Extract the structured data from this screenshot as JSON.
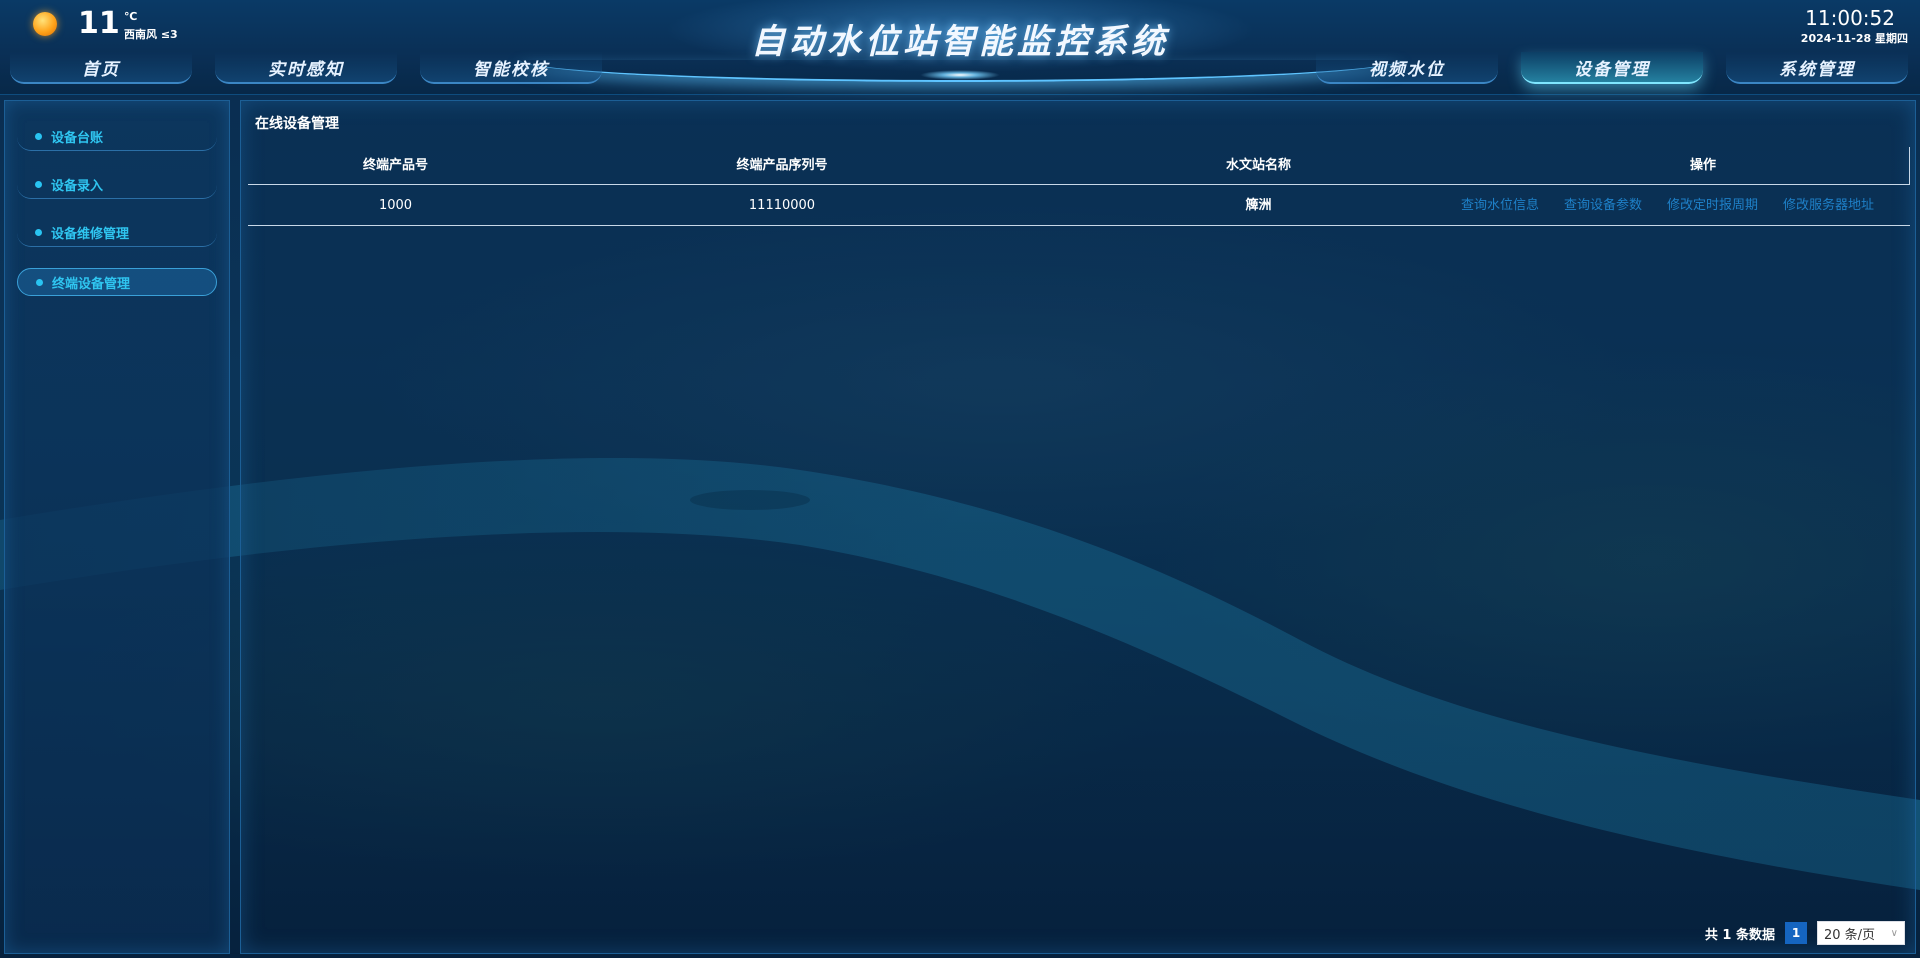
{
  "header": {
    "title": "自动水位站智能监控系统",
    "weather": {
      "icon": "sun-icon",
      "temperature": "11",
      "unit": "℃",
      "wind": "西南风 ≤3"
    },
    "time": "11:00:52",
    "date": "2024-11-28 星期四",
    "nav": [
      {
        "label": "首页",
        "active": false
      },
      {
        "label": "实时感知",
        "active": false
      },
      {
        "label": "智能校核",
        "active": false
      },
      {
        "label": "视频水位",
        "active": false
      },
      {
        "label": "设备管理",
        "active": true
      },
      {
        "label": "系统管理",
        "active": false
      }
    ]
  },
  "sidebar": {
    "items": [
      {
        "label": "设备台账",
        "active": false
      },
      {
        "label": "设备录入",
        "active": false
      },
      {
        "label": "设备维修管理",
        "active": false
      },
      {
        "label": "终端设备管理",
        "active": true
      }
    ]
  },
  "main": {
    "title": "在线设备管理",
    "columns": [
      "终端产品号",
      "终端产品序列号",
      "水文站名称",
      "操作"
    ],
    "rows": [
      {
        "product_no": "1000",
        "serial_no": "11110000",
        "station": "簰洲",
        "actions": [
          "查询水位信息",
          "查询设备参数",
          "修改定时报周期",
          "修改服务器地址"
        ]
      }
    ],
    "pagination": {
      "total_text": "共 1 条数据",
      "current_page": "1",
      "page_size": "20 条/页"
    }
  },
  "colors": {
    "accent": "#29c4f2",
    "link": "#1e80c8",
    "page_active": "#1565c0"
  }
}
